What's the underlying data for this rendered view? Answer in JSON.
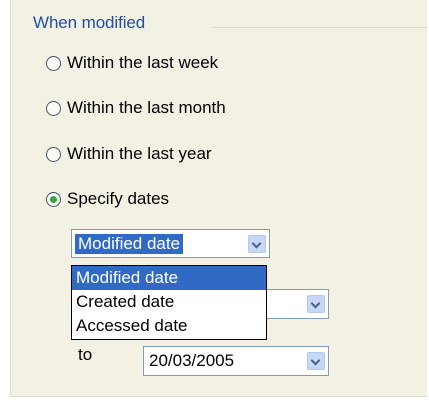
{
  "group": {
    "title": "When modified"
  },
  "radios": [
    {
      "label": "Within the last week",
      "checked": false
    },
    {
      "label": "Within the last month",
      "checked": false
    },
    {
      "label": "Within the last year",
      "checked": false
    },
    {
      "label": "Specify dates",
      "checked": true
    }
  ],
  "date_type": {
    "selected": "Modified date",
    "options": [
      "Modified date",
      "Created date",
      "Accessed date"
    ]
  },
  "range": {
    "to_label": "to",
    "to_value": "20/03/2005"
  },
  "icons": {
    "dropdown_arrow": "chevron-down-icon",
    "radio": "radio-circle"
  },
  "colors": {
    "panel_bg": "#f3f1e4",
    "group_title": "#1f4ea8",
    "selection": "#316ac5",
    "radio_checked": "#2fa836",
    "combo_border": "#7f9db9",
    "arrow_button": "#c6d8f6"
  }
}
